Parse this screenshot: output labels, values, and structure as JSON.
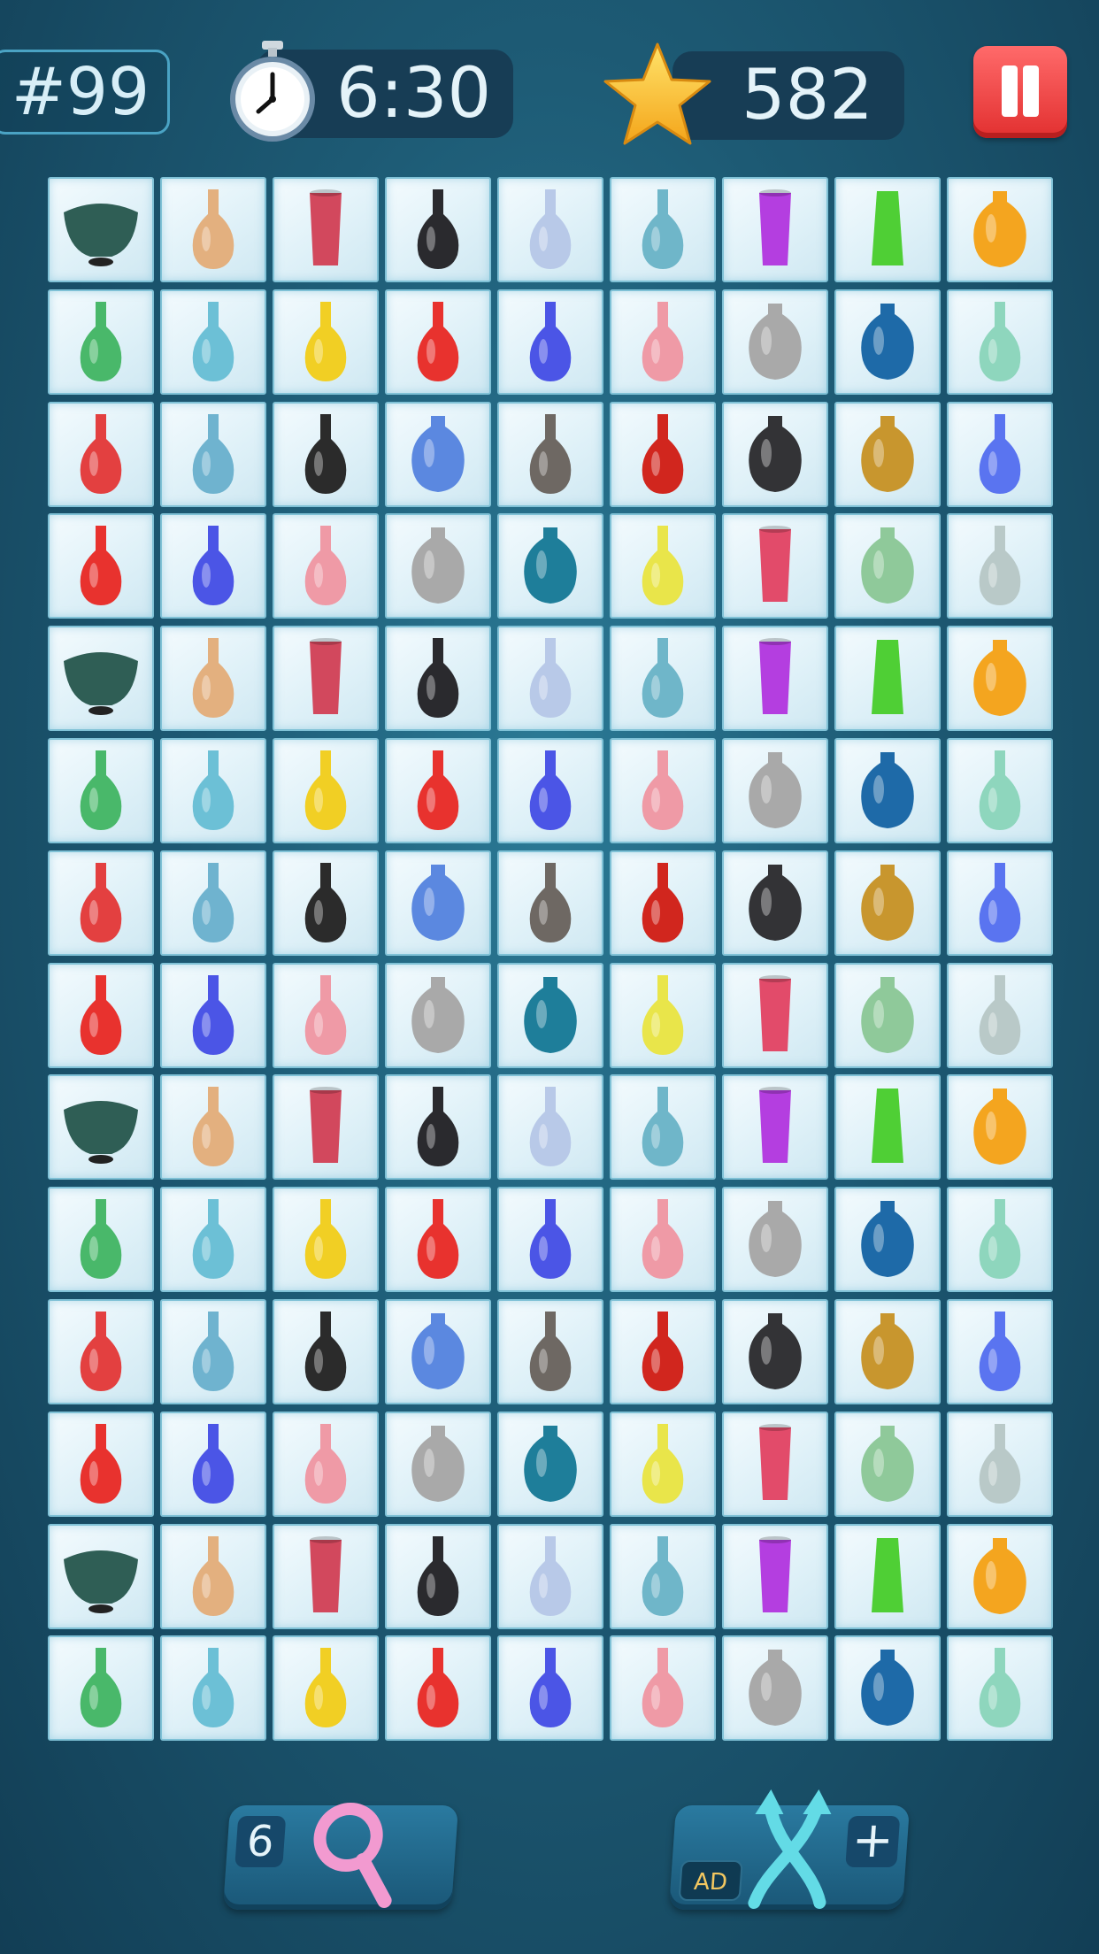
{
  "header": {
    "level_label": "#99",
    "timer": "6:30",
    "score": "582",
    "icons": {
      "timer": "stopwatch-icon",
      "score": "star-icon",
      "pause": "pause-icon"
    }
  },
  "board": {
    "rows": 14,
    "cols": 9,
    "row_pattern": [
      [
        "dark-green-bowl",
        "tan-bottle",
        "red-square-vase",
        "black-white-vase",
        "light-blue-hex-vase",
        "teal-bud-vase",
        "purple-slim-vase",
        "green-vase",
        "orange-round-vase"
      ],
      [
        "green-twisted-vase",
        "blue-lattice-vase",
        "yellow-gradient-vase",
        "red-glass-vase",
        "blue-spiral-vase",
        "pink-vase",
        "silver-mesh-vase",
        "blue-ombre-vase",
        "mint-pedestal-vase"
      ],
      [
        "red-ruffle-vase",
        "blue-fluted-vase",
        "black-twist-vase",
        "blue-squat-vase",
        "grey-bud-vase",
        "red-tall-vase",
        "black-mesh-vase",
        "gold-mesh-vase",
        "blue-slim-bud-vase"
      ],
      [
        "red-glass-vase",
        "blue-spiral-vase",
        "pink-vase",
        "silver-mesh-vase",
        "teal-ombre-vase",
        "yellow-spiral-vase",
        "pink-slim-vase",
        "green-celadon-vase",
        "silver-abstract-vase"
      ]
    ],
    "colors": {
      "dark-green-bowl": "#2f5e55",
      "tan-bottle": "#e3b07f",
      "red-square-vase": "#d2485d",
      "black-white-vase": "#2a2a2e",
      "light-blue-hex-vase": "#b8c9e8",
      "teal-bud-vase": "#6fb6c9",
      "purple-slim-vase": "#b43ee0",
      "green-vase": "#4fcf35",
      "orange-round-vase": "#f4a51f",
      "green-twisted-vase": "#49b86a",
      "blue-lattice-vase": "#6cc0d6",
      "yellow-gradient-vase": "#f1cf24",
      "red-glass-vase": "#e8322e",
      "blue-spiral-vase": "#4b55e6",
      "pink-vase": "#ef9aa6",
      "silver-mesh-vase": "#a9a9a9",
      "blue-ombre-vase": "#1e6aa8",
      "mint-pedestal-vase": "#8ed6bd",
      "red-ruffle-vase": "#e34040",
      "blue-fluted-vase": "#6fb3cf",
      "black-twist-vase": "#2b2b2b",
      "blue-squat-vase": "#5b88e0",
      "grey-bud-vase": "#6e6863",
      "red-tall-vase": "#d1261e",
      "black-mesh-vase": "#333336",
      "gold-mesh-vase": "#c8962e",
      "blue-slim-bud-vase": "#5a74f0",
      "teal-ombre-vase": "#1e7e9a",
      "yellow-spiral-vase": "#e9e54a",
      "pink-slim-vase": "#e24b6a",
      "green-celadon-vase": "#8fc99a",
      "silver-abstract-vase": "#b9c9c8"
    }
  },
  "footer": {
    "hint_count": "6",
    "hint_icon": "magnifier-icon",
    "shuffle_icon": "shuffle-arrows-icon",
    "ad_label": "AD",
    "plus_label": "+"
  }
}
